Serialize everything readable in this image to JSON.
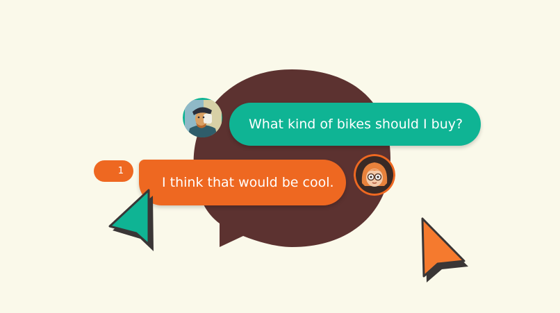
{
  "messages": [
    {
      "text": "What kind of bikes should I buy?",
      "color": "#0FB494"
    },
    {
      "text": "I think that would be cool.",
      "color": "#EE6821"
    }
  ],
  "badge": {
    "count": "1"
  },
  "colors": {
    "background": "#FAF9EA",
    "big_bubble": "#5C3230",
    "green": "#0FB494",
    "orange": "#EE6821",
    "cursor_orange": "#F57A2E",
    "cursor_shadow": "#3A3636"
  },
  "avatars": [
    {
      "name": "van-gogh-portrait"
    },
    {
      "name": "redhead-girl-with-glasses"
    }
  ]
}
